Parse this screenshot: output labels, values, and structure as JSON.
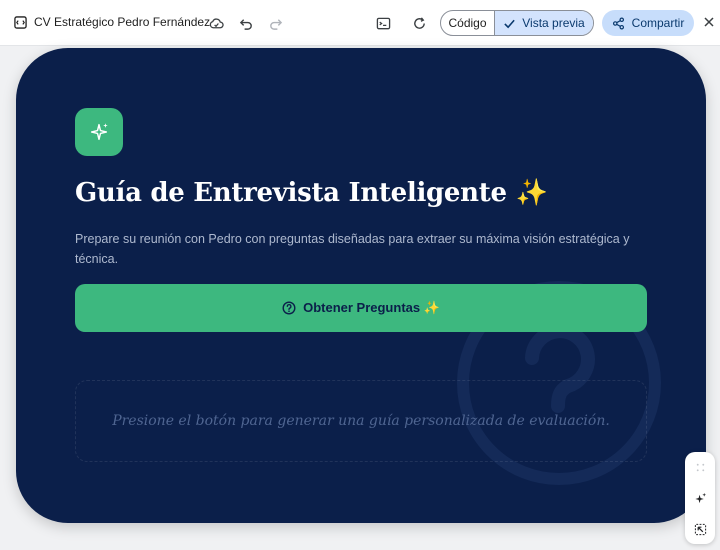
{
  "header": {
    "title": "CV Estratégico Pedro Fernández",
    "icons": [
      "document-icon",
      "cloud-sync-icon",
      "undo-icon",
      "redo-icon",
      "terminal-icon",
      "refresh-icon",
      "close-icon"
    ],
    "view_toggle": {
      "code_label": "Código",
      "preview_label": "Vista previa",
      "selected": "Vista previa"
    },
    "share_label": "Compartir",
    "colors": {
      "toggle_selected_bg": "#d3e3fd",
      "share_bg": "#c7ddfb",
      "accent_text": "#0b3a6e"
    }
  },
  "card": {
    "heading": "Guía de Entrevista Inteligente ✨",
    "description": "Prepare su reunión con Pedro con preguntas diseñadas para extraer su máxima visión estratégica y técnica.",
    "cta_label": "Obtener Preguntas ✨",
    "cta_icon": "question-circle-icon",
    "placeholder": "Presione el botón para generar una guía personalizada de evaluación.",
    "icon": "sparkles-icon",
    "colors": {
      "background": "#0b1f4a",
      "accent": "#3db87f",
      "text": "#ffffff",
      "muted": "#aeb9cf"
    }
  },
  "floating_toolbar": {
    "icons": [
      "drag-handle-icon",
      "sparkle-edit-icon",
      "select-element-icon"
    ]
  }
}
